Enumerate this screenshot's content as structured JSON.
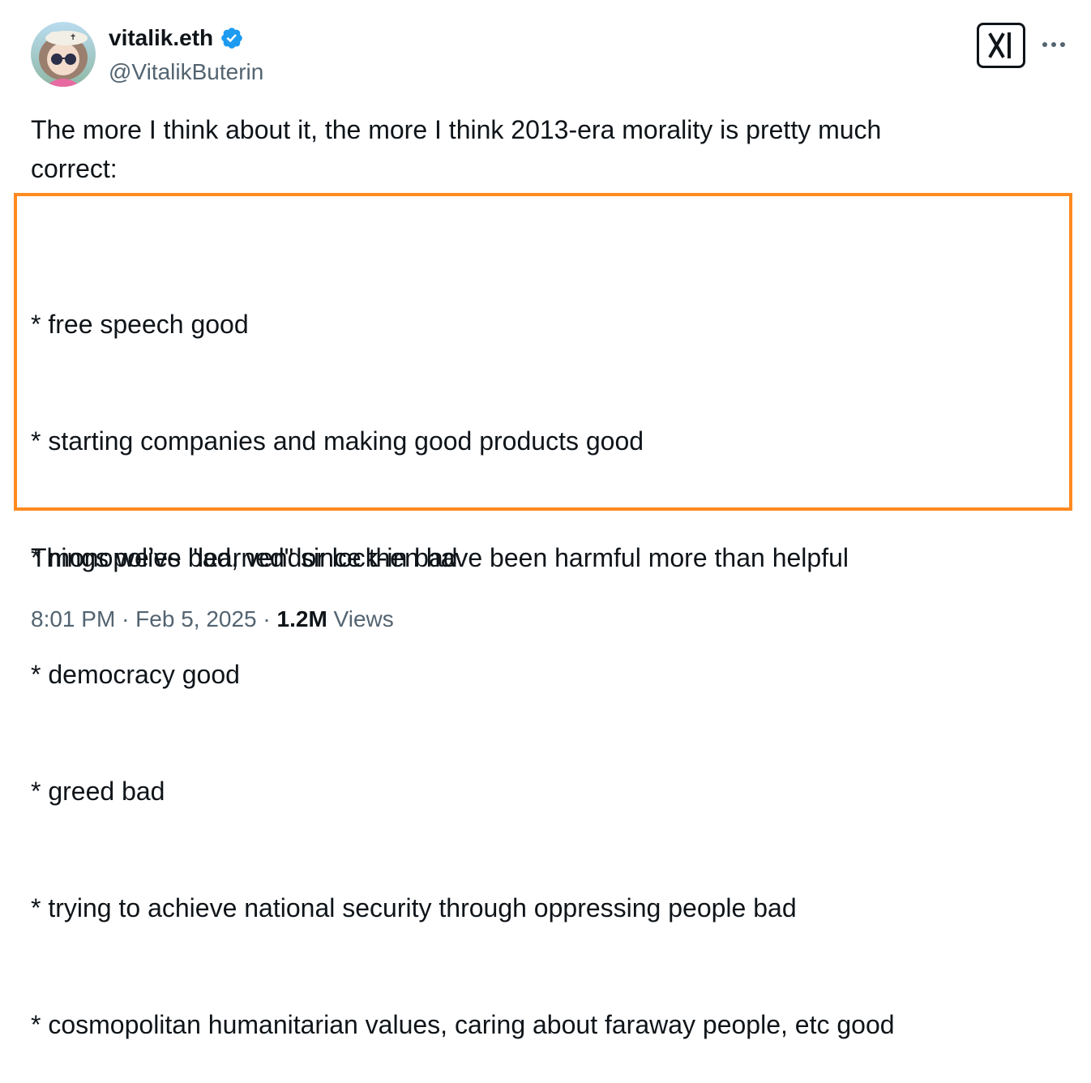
{
  "author": {
    "display_name": "vitalik.eth",
    "handle": "@VitalikButerin",
    "verified": true,
    "verified_color": "#1d9bf0"
  },
  "header_actions": {
    "grok_icon": "grok-logo-icon",
    "more_icon": "more-horizontal-icon"
  },
  "tweet": {
    "intro_line_1": "The more I think about it, the more I think 2013-era morality is pretty much",
    "intro_line_2": "correct:",
    "bullets": [
      "* free speech good",
      "* starting companies and making good products good",
      "* monopolies bad, vendor lock-in bad",
      "* democracy good",
      "* greed bad",
      "* trying to achieve national security through oppressing people bad",
      "* cosmopolitan humanitarian values, caring about faraway people, etc good"
    ],
    "outro": "Things we've \"learned\" since then have been harmful more than helpful"
  },
  "meta": {
    "time": "8:01 PM",
    "separator": "·",
    "date": "Feb 5, 2025",
    "views_count": "1.2M",
    "views_label": "Views"
  },
  "colors": {
    "highlight_border": "#ff8a1f",
    "text_primary": "#0f1419",
    "text_secondary": "#536471"
  }
}
